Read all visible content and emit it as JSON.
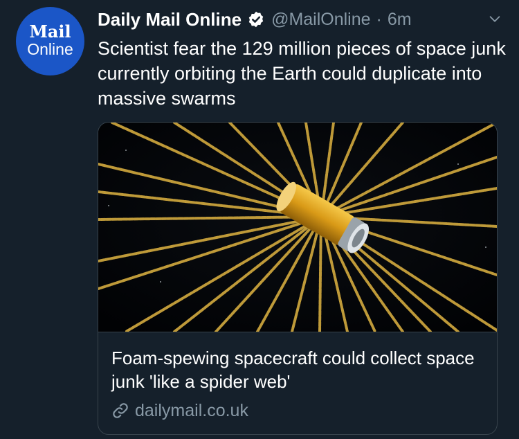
{
  "tweet": {
    "avatar": {
      "line1": "Mail",
      "line2": "Online",
      "color": "#1b56c7"
    },
    "author_name": "Daily Mail Online",
    "handle": "@MailOnline",
    "separator": "·",
    "time": "6m",
    "verified": true,
    "text": "Scientist fear the 129 million pieces of space junk currently orbiting the Earth could duplicate into massive swarms",
    "card": {
      "image_icon": "spacecraft-foam-web-image",
      "title": "Foam-spewing spacecraft could collect space junk 'like a spider web'",
      "domain": "dailymail.co.uk"
    }
  },
  "colors": {
    "background": "#15202b",
    "muted_text": "#8899a6",
    "border": "#38444d",
    "verified_badge": "#ffffff"
  }
}
